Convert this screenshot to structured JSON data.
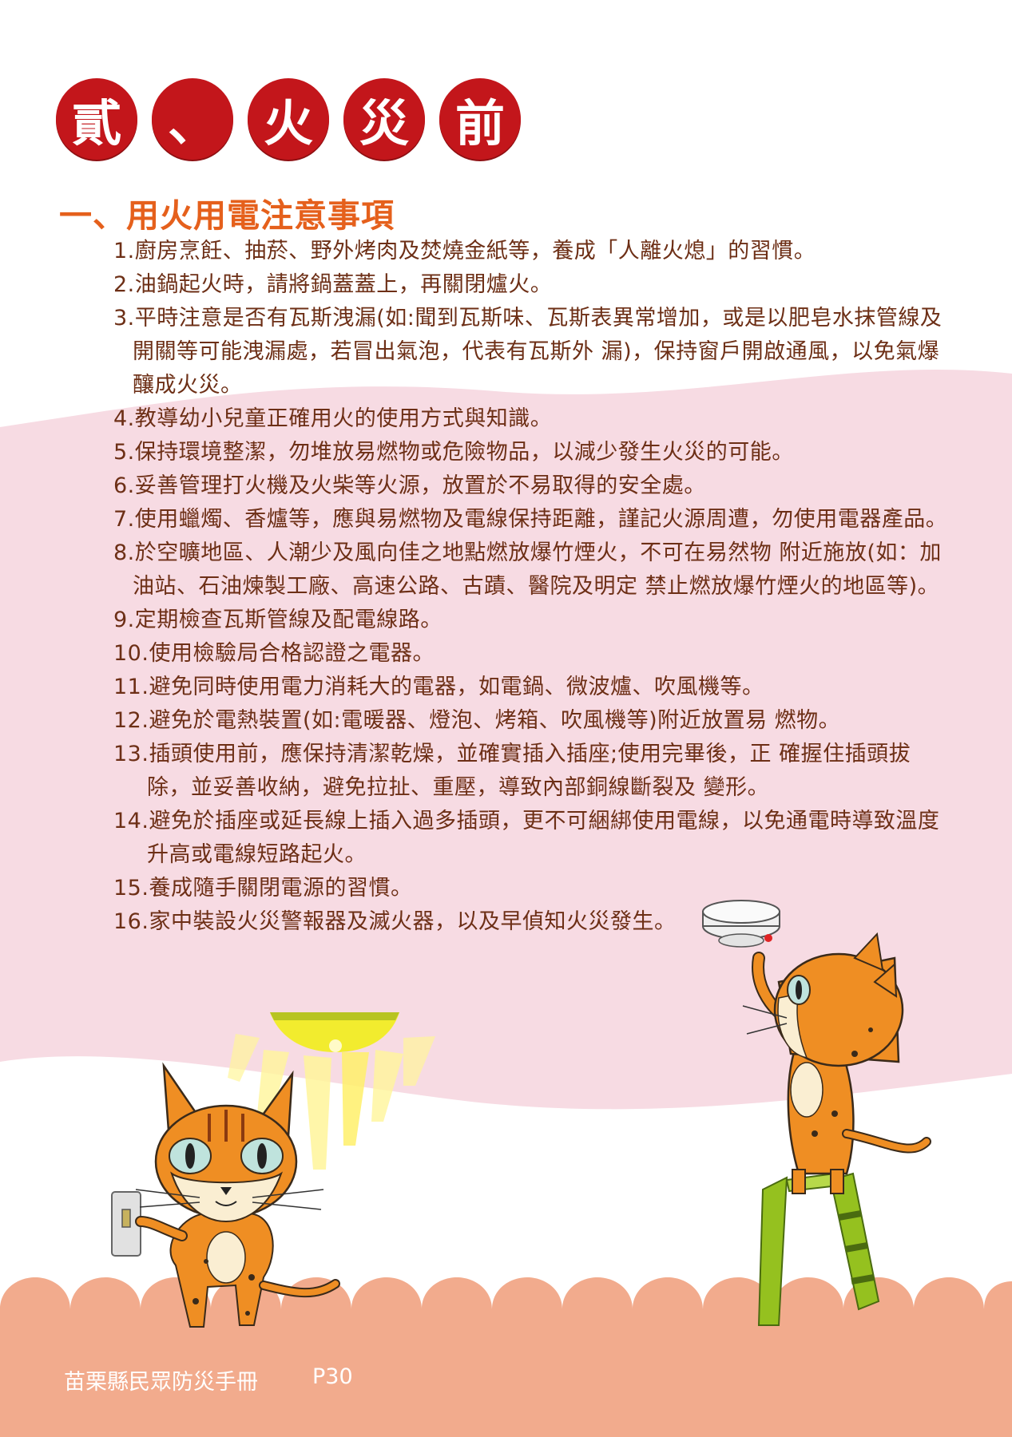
{
  "title_chars": [
    "貳",
    "、",
    "火",
    "災",
    "前"
  ],
  "section_heading": "一、用火用電注意事項",
  "items": [
    "1.廚房烹飪、抽菸、野外烤肉及焚燒金紙等，養成「人離火熄」的習慣。",
    "2.油鍋起火時，請將鍋蓋蓋上，再關閉爐火。",
    "3.平時注意是否有瓦斯洩漏(如:聞到瓦斯味、瓦斯表異常增加，或是以肥皂水抹管線及開關等可能洩漏處，若冒出氣泡，代表有瓦斯外 漏)，保持窗戶開啟通風，以免氣爆釀成火災。",
    "4.教導幼小兒童正確用火的使用方式與知識。",
    "5.保持環境整潔，勿堆放易燃物或危險物品，以減少發生火災的可能。",
    "6.妥善管理打火機及火柴等火源，放置於不易取得的安全處。",
    "7.使用蠟燭、香爐等，應與易燃物及電線保持距離，謹記火源周遭，勿使用電器產品。",
    "8.於空曠地區、人潮少及風向佳之地點燃放爆竹煙火，不可在易然物 附近施放(如：加油站、石油煉製工廠、高速公路、古蹟、醫院及明定 禁止燃放爆竹煙火的地區等)。",
    "9.定期檢查瓦斯管線及配電線路。",
    "10.使用檢驗局合格認證之電器。",
    "11.避免同時使用電力消耗大的電器，如電鍋、微波爐、吹風機等。",
    "12.避免於電熱裝置(如:電暖器、燈泡、烤箱、吹風機等)附近放置易 燃物。",
    "13.插頭使用前，應保持清潔乾燥，並確實插入插座;使用完畢後，正 確握住插頭拔除，並妥善收納，避免拉扯、重壓，導致內部銅線斷裂及 變形。",
    "14.避免於插座或延長線上插入過多插頭，更不可綑綁使用電線，以免通電時導致溫度升高或電線短路起火。",
    "15.養成隨手關閉電源的習慣。",
    "16.家中裝設火災警報器及滅火器，以及早偵知火災發生。"
  ],
  "footer": {
    "book_title": "苗栗縣民眾防災手冊",
    "page_number": "P30"
  },
  "colors": {
    "title_circle": "#c3161b",
    "heading": "#e5601c",
    "body_text": "#6d2f16",
    "pink_band": "#f7dbe3",
    "footer_band": "#f2ab8d"
  },
  "illustrations": [
    "cat-switch-icon",
    "ceiling-light-icon",
    "smoke-detector-icon",
    "cat-ladder-icon"
  ]
}
